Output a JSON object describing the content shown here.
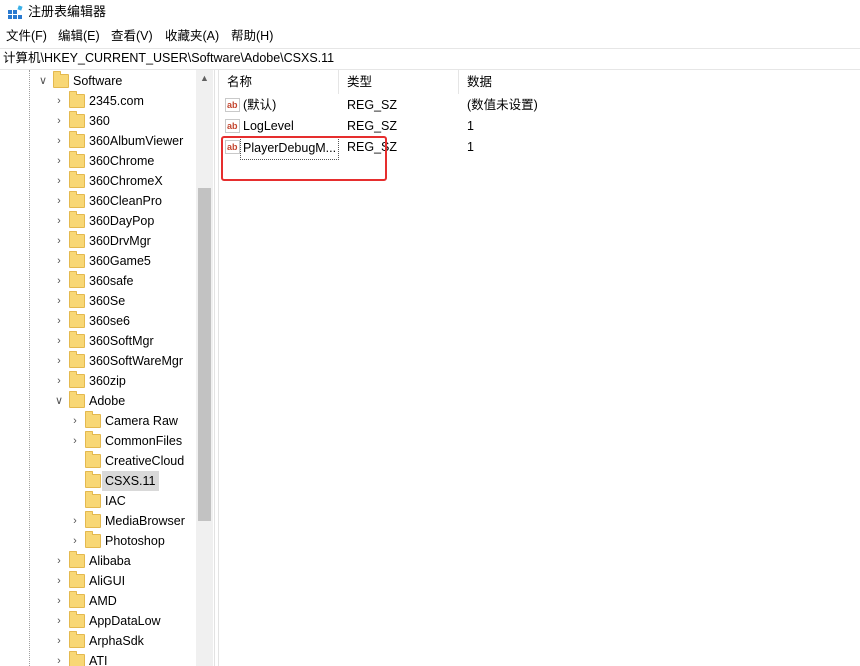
{
  "window": {
    "title": "注册表编辑器"
  },
  "menu": [
    "文件(F)",
    "编辑(E)",
    "查看(V)",
    "收藏夹(A)",
    "帮助(H)"
  ],
  "address": "计算机\\HKEY_CURRENT_USER\\Software\\Adobe\\CSXS.11",
  "tree": {
    "root": "Software",
    "items": [
      "2345.com",
      "360",
      "360AlbumViewer",
      "360Chrome",
      "360ChromeX",
      "360CleanPro",
      "360DayPop",
      "360DrvMgr",
      "360Game5",
      "360safe",
      "360Se",
      "360se6",
      "360SoftMgr",
      "360SoftWareMgr",
      "360zip",
      "Adobe"
    ],
    "adobe_children": [
      "Camera Raw",
      "CommonFiles",
      "CreativeCloud",
      "CSXS.11",
      "IAC",
      "MediaBrowser",
      "Photoshop"
    ],
    "after": [
      "Alibaba",
      "AliGUI",
      "AMD",
      "AppDataLow",
      "ArphaSdk",
      "ATI"
    ],
    "selected": "CSXS.11"
  },
  "list": {
    "headers": [
      "名称",
      "类型",
      "数据"
    ],
    "rows": [
      {
        "name": "(默认)",
        "type": "REG_SZ",
        "data": "(数值未设置)"
      },
      {
        "name": "LogLevel",
        "type": "REG_SZ",
        "data": "1"
      },
      {
        "name": "PlayerDebugM...",
        "type": "REG_SZ",
        "data": "1"
      }
    ]
  },
  "icons": {
    "app": "registry-icon",
    "value": "string-value-icon",
    "folder": "folder-icon"
  },
  "colors": {
    "highlight": "#e62e2e",
    "folder": "#f8d775",
    "selection": "#d9d9d9"
  }
}
